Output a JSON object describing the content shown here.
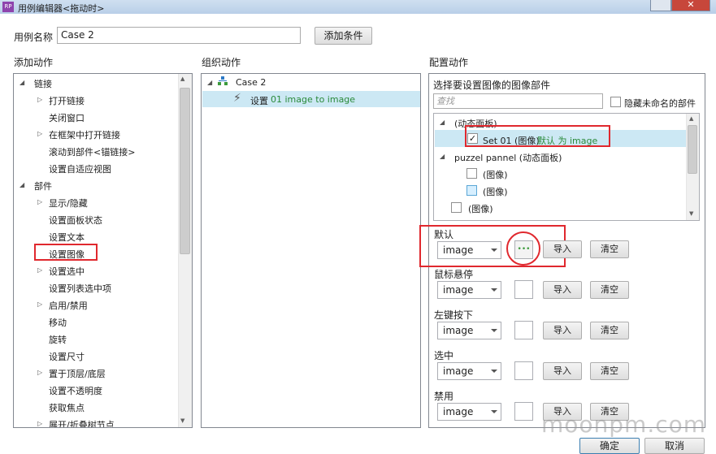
{
  "window": {
    "title": "用例编辑器<拖动时>"
  },
  "case_name": {
    "label": "用例名称",
    "value": "Case 2",
    "add_condition": "添加条件"
  },
  "sections": {
    "add_actions": "添加动作",
    "organize_actions": "组织动作",
    "configure_actions": "配置动作"
  },
  "tree": {
    "group_link": "链接",
    "open_link": "打开链接",
    "close_window": "关闭窗口",
    "open_in_frame": "在框架中打开链接",
    "scroll_to": "滚动到部件<锚链接>",
    "set_adaptive": "设置自适应视图",
    "group_widget": "部件",
    "show_hide": "显示/隐藏",
    "set_panel_state": "设置面板状态",
    "set_text": "设置文本",
    "set_image": "设置图像",
    "set_selected": "设置选中",
    "set_list_item": "设置列表选中项",
    "enable_disable": "启用/禁用",
    "move": "移动",
    "rotate": "旋转",
    "set_size": "设置尺寸",
    "bring_front": "置于顶层/底层",
    "set_opacity": "设置不透明度",
    "focus": "获取焦点",
    "expand_tree": "展开/折叠树节点"
  },
  "organize": {
    "case": "Case 2",
    "action_prefix": "设置",
    "action_detail": "01 image to image"
  },
  "config": {
    "select_label": "选择要设置图像的图像部件",
    "search_placeholder": "查找",
    "hide_unnamed": "隐藏未命名的部件",
    "node_dynamic": "(动态面板)",
    "item_set01": "Set 01 (图像)",
    "item_set01_detail": "默认 为 image",
    "node_puzzel": "puzzel pannel (动态面板)",
    "img_a": "(图像)",
    "img_b": "(图像)",
    "img_c": "(图像)",
    "states": [
      {
        "label": "默认",
        "value": "image"
      },
      {
        "label": "鼠标悬停",
        "value": "image"
      },
      {
        "label": "左键按下",
        "value": "image"
      },
      {
        "label": "选中",
        "value": "image"
      },
      {
        "label": "禁用",
        "value": "image"
      }
    ],
    "import_label": "导入",
    "clear_label": "清空"
  },
  "footer": {
    "ok": "确定",
    "cancel": "取消"
  },
  "watermark": "moonpm.com"
}
